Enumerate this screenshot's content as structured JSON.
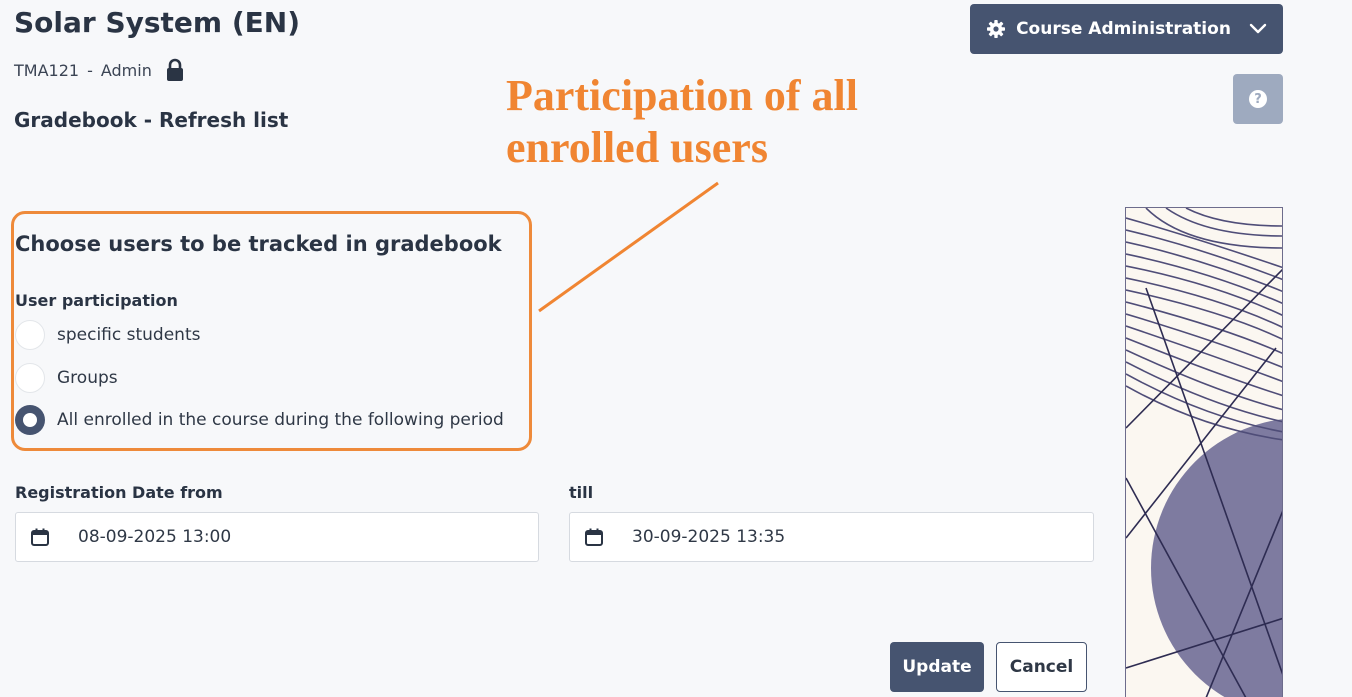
{
  "header": {
    "course_title": "Solar System (EN)",
    "course_code": "TMA121",
    "separator": "-",
    "role": "Admin",
    "page_heading": "Gradebook - Refresh list"
  },
  "toolbar": {
    "admin_label": "Course Administration",
    "help_label": "?"
  },
  "annotation": {
    "line1": "Participation of all",
    "line2": "enrolled users",
    "color": "#f08532"
  },
  "form": {
    "section_title": "Choose users to be tracked in gradebook",
    "participation_label": "User participation",
    "options": [
      {
        "label": "specific students",
        "checked": false
      },
      {
        "label": "Groups",
        "checked": false
      },
      {
        "label": "All enrolled in the course during the following period",
        "checked": true
      }
    ],
    "date_from_label": "Registration Date from",
    "date_from_value": "08-09-2025 13:00",
    "date_till_label": "till",
    "date_till_value": "30-09-2025 13:35"
  },
  "actions": {
    "update_label": "Update",
    "cancel_label": "Cancel"
  },
  "colors": {
    "primary": "#465470",
    "help_button": "#9eaabf",
    "highlight": "#ee8a3a"
  }
}
